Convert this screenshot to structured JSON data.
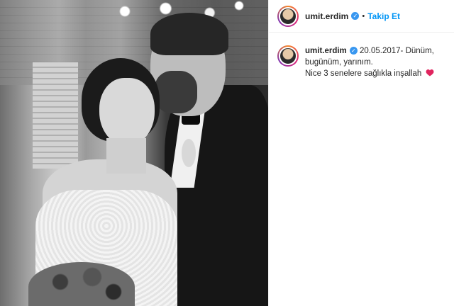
{
  "post": {
    "username": "umit.erdim",
    "separator": "•",
    "follow_label": "Takip Et",
    "caption_line1": "20.05.2017- Dünüm,",
    "caption_line2": "bugünüm, yarınım.",
    "caption_line3": "Nice 3 senelere sağlıkla inşallah",
    "verified_glyph": "✓"
  },
  "colors": {
    "accent": "#0095f6",
    "verified": "#3897f0",
    "heart": "#e0245e"
  },
  "icons": {
    "verified": "verified-badge-icon",
    "heart": "heart-icon"
  }
}
